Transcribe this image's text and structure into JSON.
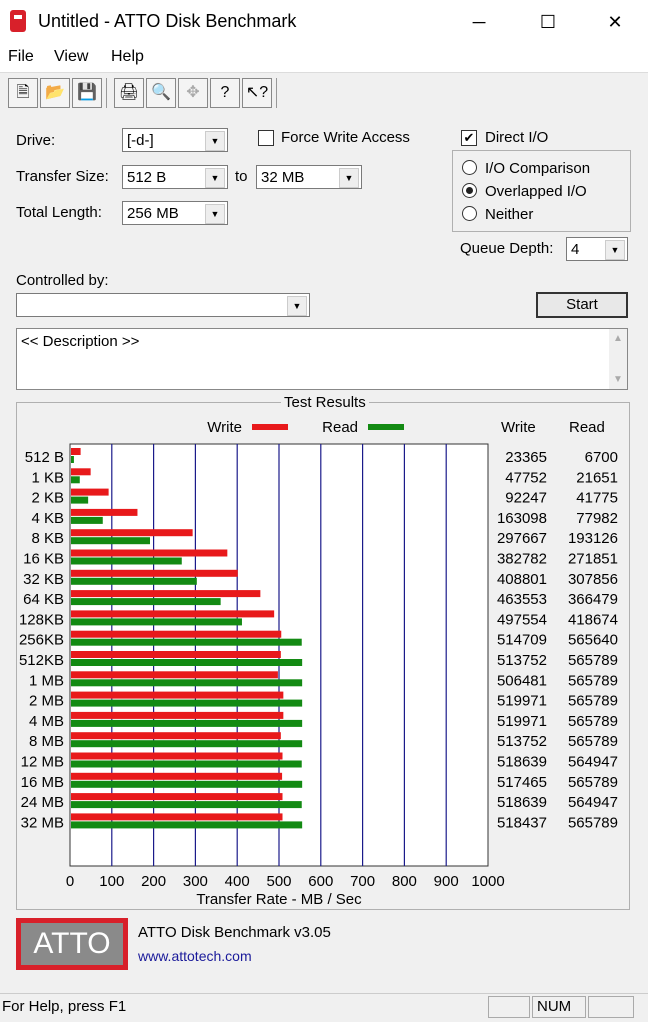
{
  "window": {
    "title": "Untitled - ATTO Disk Benchmark",
    "minimize": "─",
    "maximize": "☐",
    "close": "✕"
  },
  "menu": {
    "items": [
      "File",
      "View",
      "Help"
    ]
  },
  "toolbar": {
    "icons": [
      "new-icon",
      "open-icon",
      "save-icon",
      "print-icon",
      "print-preview-icon",
      "move-icon",
      "help-icon",
      "context-help-icon"
    ]
  },
  "settings": {
    "drive_label": "Drive:",
    "drive_value": "[-d-]",
    "transfer_size_label": "Transfer Size:",
    "transfer_from": "512 B",
    "to_label": "to",
    "transfer_to": "32 MB",
    "total_length_label": "Total Length:",
    "total_length": "256 MB",
    "force_write_label": "Force Write Access",
    "force_write_checked": false,
    "direct_io_label": "Direct I/O",
    "direct_io_checked": true,
    "io_comparison_label": "I/O Comparison",
    "overlapped_io_label": "Overlapped I/O",
    "neither_label": "Neither",
    "selected_io_mode": "Overlapped I/O",
    "queue_depth_label": "Queue Depth:",
    "queue_depth": "4",
    "controlled_by_label": "Controlled by:",
    "controlled_by": "",
    "start_label": "Start",
    "description": "<< Description >>"
  },
  "results": {
    "title": "Test Results",
    "write_legend": "Write",
    "read_legend": "Read",
    "write_header": "Write",
    "read_header": "Read",
    "xlabel": "Transfer Rate - MB / Sec",
    "write_color": "#e8191b",
    "read_color": "#138a13"
  },
  "chart_data": {
    "type": "bar",
    "orientation": "horizontal",
    "title": "Test Results",
    "xlabel": "Transfer Rate - MB / Sec",
    "xlim": [
      0,
      1000
    ],
    "xticks": [
      0,
      100,
      200,
      300,
      400,
      500,
      600,
      700,
      800,
      900,
      1000
    ],
    "categories": [
      "512 B",
      "1 KB",
      "2 KB",
      "4 KB",
      "8 KB",
      "16 KB",
      "32 KB",
      "64 KB",
      "128KB",
      "256KB",
      "512KB",
      "1 MB",
      "2 MB",
      "4 MB",
      "8 MB",
      "12 MB",
      "16 MB",
      "24 MB",
      "32 MB"
    ],
    "series": [
      {
        "name": "Write",
        "color": "#e8191b",
        "values_mbps": [
          23,
          47,
          90,
          159,
          291,
          374,
          399,
          453,
          486,
          503,
          502,
          495,
          508,
          508,
          502,
          506,
          505,
          506,
          506
        ],
        "printed": [
          23365,
          47752,
          92247,
          163098,
          297667,
          382782,
          408801,
          463553,
          497554,
          514709,
          513752,
          506481,
          519971,
          519971,
          513752,
          518639,
          517465,
          518639,
          518437
        ]
      },
      {
        "name": "Read",
        "color": "#138a13",
        "values_mbps": [
          7,
          21,
          41,
          76,
          189,
          265,
          301,
          358,
          409,
          552,
          553,
          553,
          553,
          553,
          553,
          552,
          553,
          552,
          553
        ],
        "printed": [
          6700,
          21651,
          41775,
          77982,
          193126,
          271851,
          307856,
          366479,
          418674,
          565640,
          565789,
          565789,
          565789,
          565789,
          565789,
          564947,
          565789,
          564947,
          565789
        ]
      }
    ],
    "grid": true,
    "legend": "top"
  },
  "footer": {
    "product": "ATTO Disk Benchmark v3.05",
    "url": "www.attotech.com",
    "logo_text": "ATTO"
  },
  "status": {
    "help_text": "For Help, press F1",
    "num": "NUM"
  }
}
